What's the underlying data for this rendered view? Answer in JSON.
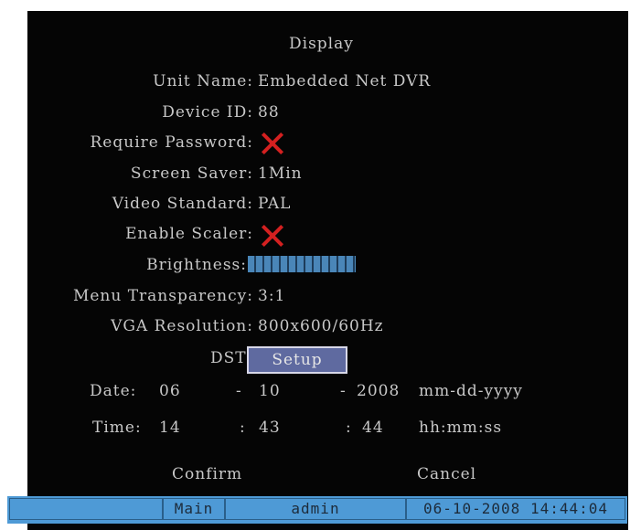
{
  "title": "Display",
  "fields": {
    "unit_name_label": "Unit Name:",
    "unit_name_value": "Embedded Net DVR",
    "device_id_label": "Device ID:",
    "device_id_value": "88",
    "require_password_label": "Require Password:",
    "require_password_checked": false,
    "screen_saver_label": "Screen Saver:",
    "screen_saver_value": "1Min",
    "video_standard_label": "Video Standard:",
    "video_standard_value": "PAL",
    "enable_scaler_label": "Enable Scaler:",
    "enable_scaler_checked": false,
    "brightness_label": "Brightness:",
    "brightness_level": 1.0,
    "menu_transparency_label": "Menu Transparency:",
    "menu_transparency_value": "3:1",
    "vga_resolution_label": "VGA Resolution:",
    "vga_resolution_value": "800x600/60Hz",
    "dst_label": "DST:",
    "dst_button": "Setup"
  },
  "date": {
    "label": "Date:",
    "month": "06",
    "sep1": "-",
    "day": "10",
    "sep2": "-",
    "year": "2008",
    "format": "mm-dd-yyyy"
  },
  "time": {
    "label": "Time:",
    "hour": "14",
    "sep1": ":",
    "minute": "43",
    "sep2": ":",
    "second": "44",
    "format": "hh:mm:ss"
  },
  "actions": {
    "confirm": "Confirm",
    "cancel": "Cancel"
  },
  "statusbar": {
    "menu": "Main",
    "user": "admin",
    "datetime": "06-10-2008 14:44:04"
  },
  "colors": {
    "background": "#050505",
    "text": "#c8c8c8",
    "accent": "#4e9ad6",
    "x_mark": "#d42020",
    "button": "#5f6aa0"
  }
}
